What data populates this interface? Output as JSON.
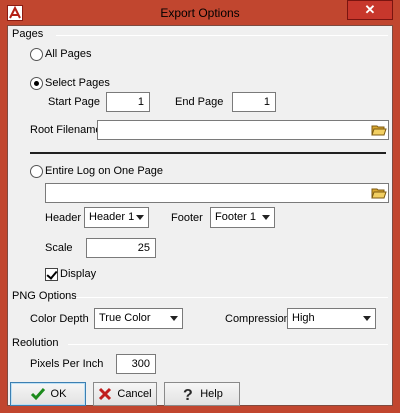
{
  "window": {
    "title": "Export Options",
    "close_glyph": "✕"
  },
  "pages": {
    "section_title": "Pages",
    "all_pages_label": "All Pages",
    "select_pages_label": "Select Pages",
    "start_page_label": "Start Page",
    "start_page_value": "1",
    "end_page_label": "End Page",
    "end_page_value": "1",
    "root_filename_label": "Root Filename",
    "root_filename_value": "",
    "entire_log_label": "Entire Log on One Page",
    "entire_log_path": "",
    "header_label": "Header",
    "header_value": "Header 1",
    "footer_label": "Footer",
    "footer_value": "Footer 1",
    "scale_label": "Scale",
    "scale_value": "25",
    "display_label": "Display",
    "selected_option": "select_pages",
    "display_checked": true
  },
  "png_options": {
    "section_title": "PNG Options",
    "color_depth_label": "Color Depth",
    "color_depth_value": "True Color",
    "compression_label": "Compression",
    "compression_value": "High"
  },
  "resolution": {
    "section_title": "Reolution",
    "ppi_label": "Pixels Per Inch",
    "ppi_value": "300"
  },
  "buttons": {
    "ok": "OK",
    "cancel": "Cancel",
    "help": "Help"
  },
  "icons": {
    "app": "app-logo-icon",
    "browse": "folder-open-icon",
    "ok": "checkmark-icon",
    "cancel": "x-icon",
    "help": "question-mark-icon"
  },
  "colors": {
    "titlebar": "#c1462f",
    "close": "#c7372c",
    "default_button_border": "#3c7fb1"
  }
}
